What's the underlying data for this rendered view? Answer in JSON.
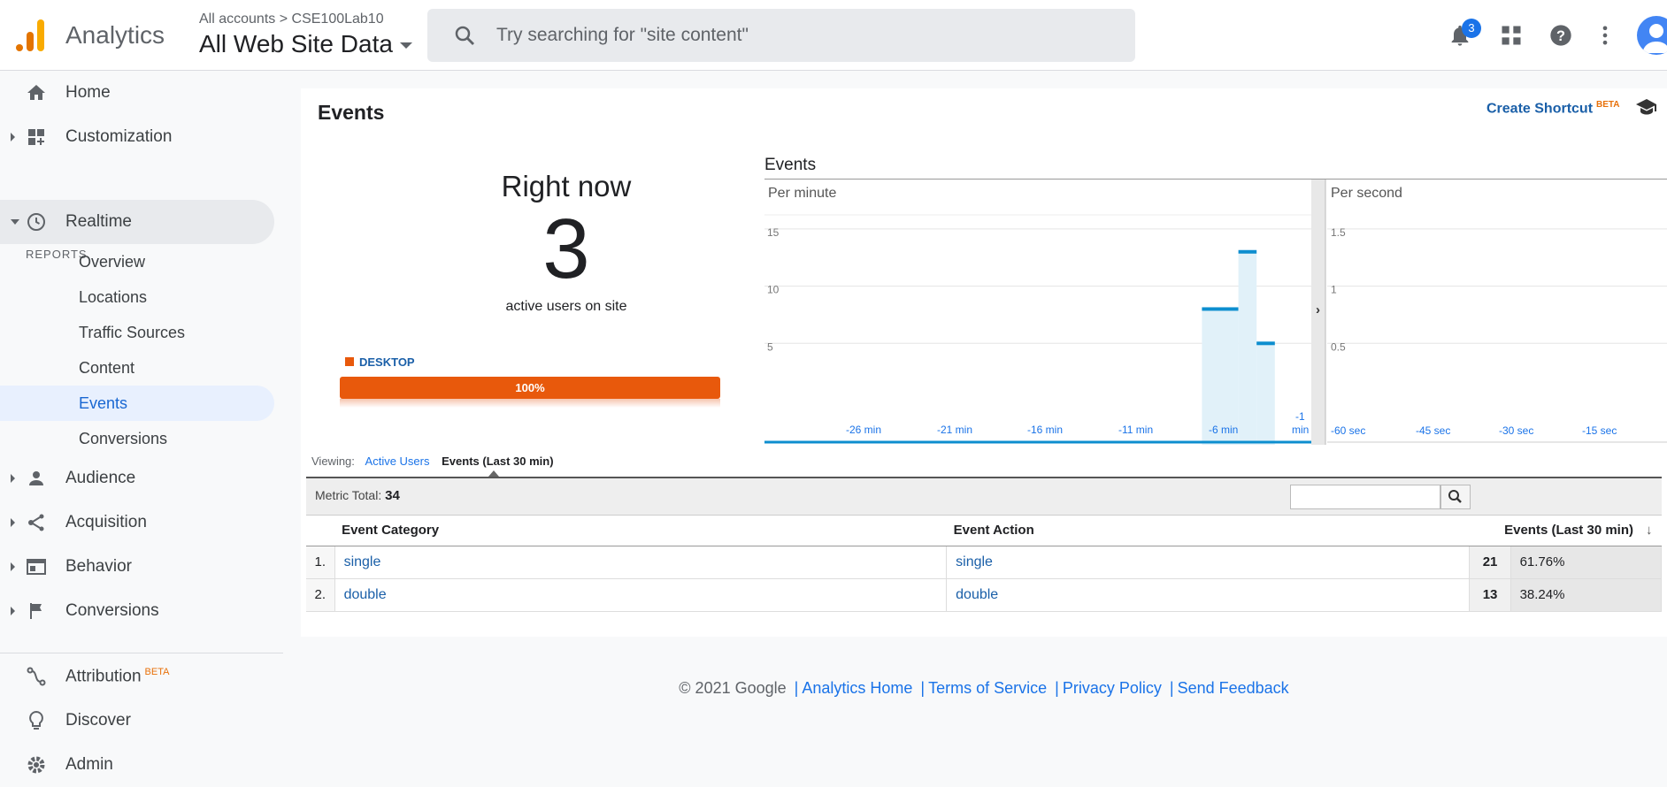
{
  "app": {
    "name": "Analytics"
  },
  "header": {
    "breadcrumb_account": "All accounts",
    "breadcrumb_property": "CSE100Lab10",
    "view": "All Web Site Data",
    "search_placeholder": "Try searching for \"site content\"",
    "notification_count": "3"
  },
  "sidebar": {
    "home": "Home",
    "customization": "Customization",
    "reports_label": "REPORTS",
    "realtime": "Realtime",
    "realtime_items": [
      "Overview",
      "Locations",
      "Traffic Sources",
      "Content",
      "Events",
      "Conversions"
    ],
    "audience": "Audience",
    "acquisition": "Acquisition",
    "behavior": "Behavior",
    "conversions": "Conversions",
    "attribution": "Attribution",
    "attribution_badge": "BETA",
    "discover": "Discover",
    "admin": "Admin"
  },
  "page": {
    "title": "Events",
    "create_shortcut": "Create Shortcut",
    "shortcut_badge": "BETA"
  },
  "rightnow": {
    "title": "Right now",
    "count": "3",
    "subtitle": "active users on site",
    "device_label": "DESKTOP",
    "device_share": "100%",
    "device_fraction": 1.0
  },
  "chart_data": [
    {
      "type": "bar",
      "title": "Events",
      "subtitle": "Per minute",
      "ylim": [
        0,
        17
      ],
      "yticks": [
        5,
        10,
        15
      ],
      "xtick_labels": [
        "-26 min",
        "-21 min",
        "-16 min",
        "-11 min",
        "-6 min",
        "-1 min"
      ],
      "x": [
        -30,
        -29,
        -28,
        -27,
        -26,
        -25,
        -24,
        -23,
        -22,
        -21,
        -20,
        -19,
        -18,
        -17,
        -16,
        -15,
        -14,
        -13,
        -12,
        -11,
        -10,
        -9,
        -8,
        -7,
        -6,
        -5,
        -4,
        -3,
        -2,
        -1
      ],
      "values": [
        0,
        0,
        0,
        0,
        0,
        0,
        0,
        0,
        0,
        0,
        0,
        0,
        0,
        0,
        0,
        0,
        0,
        0,
        0,
        0,
        0,
        0,
        0,
        0,
        8,
        8,
        13,
        5,
        0,
        0
      ]
    },
    {
      "type": "bar",
      "subtitle": "Per second",
      "ylim": [
        0,
        1.7
      ],
      "yticks": [
        0.5,
        1,
        1.5
      ],
      "xtick_labels": [
        "-60 sec",
        "-45 sec",
        "-30 sec",
        "-15 sec"
      ],
      "values": []
    }
  ],
  "viewing": {
    "label": "Viewing:",
    "option_active_users": "Active Users",
    "option_events": "Events (Last 30 min)"
  },
  "table": {
    "metric_total_label": "Metric Total:",
    "metric_total_value": "34",
    "columns": [
      "Event Category",
      "Event Action",
      "Events (Last 30 min)"
    ],
    "rows": [
      {
        "index": "1.",
        "category": "single",
        "action": "single",
        "count": "21",
        "percent": "61.76%"
      },
      {
        "index": "2.",
        "category": "double",
        "action": "double",
        "count": "13",
        "percent": "38.24%"
      }
    ]
  },
  "footer": {
    "copyright": "© 2021 Google",
    "links": [
      "Analytics Home",
      "Terms of Service",
      "Privacy Policy",
      "Send Feedback"
    ]
  },
  "colors": {
    "accent": "#1a73e8",
    "device_bar": "#e8590c",
    "chart_bar": "#0d8ecf"
  }
}
